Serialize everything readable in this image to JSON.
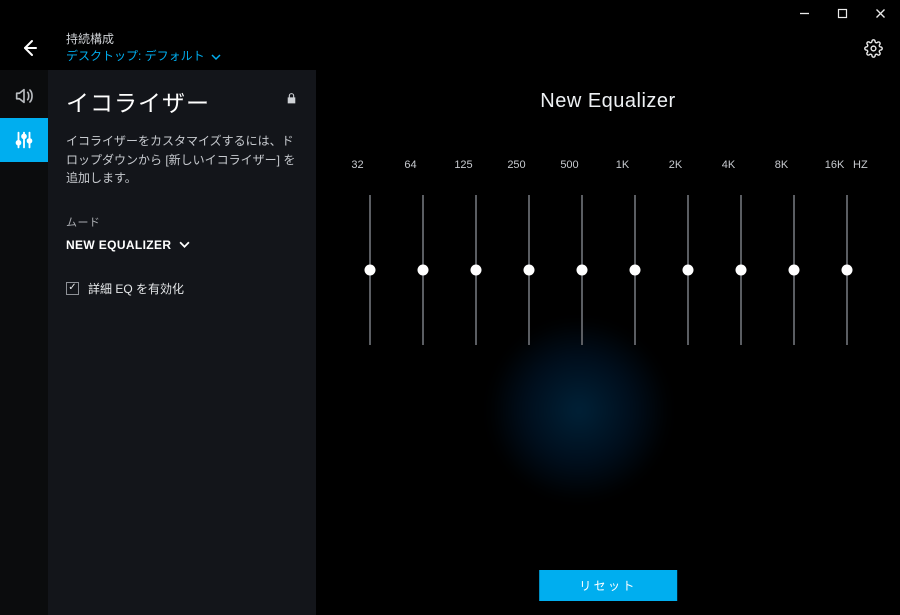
{
  "header": {
    "persist_label": "持続構成",
    "profile_label": "デスクトップ: デフォルト"
  },
  "sidepanel": {
    "title": "イコライザー",
    "description": "イコライザーをカスタマイズするには、ドロップダウンから [新しいイコライザー] を追加します。",
    "mood_label": "ムード",
    "mood_value": "NEW EQUALIZER",
    "advanced_label": "詳細 EQ を有効化",
    "advanced_checked": true
  },
  "equalizer": {
    "title": "New Equalizer",
    "hz_label": "HZ",
    "frequencies": [
      "32",
      "64",
      "125",
      "250",
      "500",
      "1K",
      "2K",
      "4K",
      "8K",
      "16K"
    ],
    "values": [
      0,
      0,
      0,
      0,
      0,
      0,
      0,
      0,
      0,
      0
    ],
    "reset_label": "リセット"
  },
  "colors": {
    "accent": "#00aeef",
    "panel_bg": "#13151a"
  }
}
